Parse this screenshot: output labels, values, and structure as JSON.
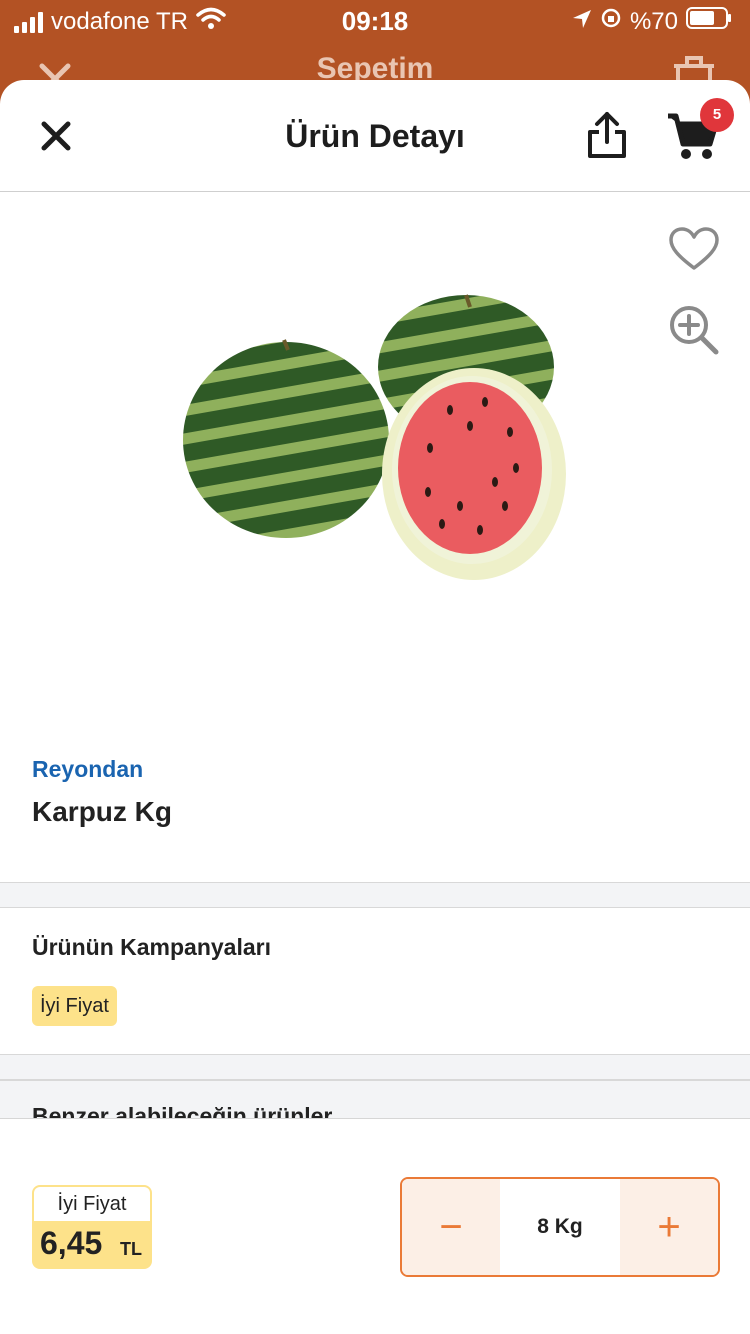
{
  "status_bar": {
    "carrier": "vodafone TR",
    "time": "09:18",
    "battery": "%70",
    "battery_level": 0.7
  },
  "behind_screen": {
    "title": "Sepetim"
  },
  "header": {
    "title": "Ürün Detayı",
    "cart_count": "5"
  },
  "product": {
    "category": "Reyondan",
    "name": "Karpuz Kg",
    "image_icon": "watermelon"
  },
  "campaigns": {
    "title": "Ürünün Kampanyaları",
    "badge": "İyi Fiyat"
  },
  "similar": {
    "title": "Benzer alabileceğin ürünler"
  },
  "price": {
    "label": "İyi Fiyat",
    "value": "6,45",
    "unit": "TL"
  },
  "quantity": {
    "minus": "−",
    "value": "8 Kg",
    "plus": "+"
  },
  "colors": {
    "accent": "#ea7a37",
    "link_blue": "#1a64b0",
    "badge_yellow": "#fde28a",
    "badge_red": "#e0363b"
  }
}
